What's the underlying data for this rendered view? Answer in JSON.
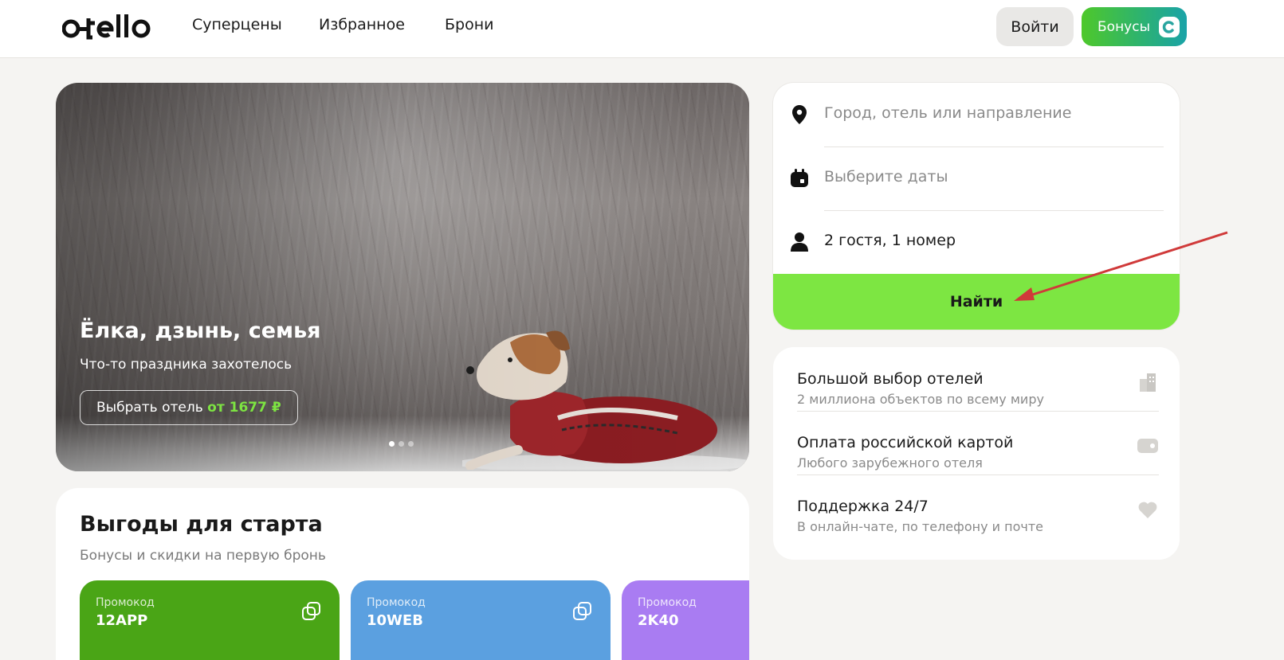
{
  "header": {
    "logo_text": "otello",
    "nav": [
      "Суперцены",
      "Избранное",
      "Брони"
    ],
    "login_label": "Войти",
    "bonus_label": "Бонусы"
  },
  "hero": {
    "title": "Ёлка, дзынь, семья",
    "subtitle": "Что-то праздника захотелось",
    "cta_prefix": "Выбрать отель",
    "cta_price": "от 1677 ₽",
    "slides_count": 3,
    "active_slide": 1
  },
  "search": {
    "destination_placeholder": "Город, отель или направление",
    "dates_placeholder": "Выберите даты",
    "guests_value": "2 гостя, 1 номер",
    "find_label": "Найти"
  },
  "features": [
    {
      "title": "Большой выбор отелей",
      "subtitle": "2 миллиона объектов по всему миру",
      "icon": "buildings-icon"
    },
    {
      "title": "Оплата российской картой",
      "subtitle": "Любого зарубежного отеля",
      "icon": "card-icon"
    },
    {
      "title": "Поддержка 24/7",
      "subtitle": "В онлайн-чате, по телефону и почте",
      "icon": "heart-icon"
    }
  ],
  "benefits": {
    "title": "Выгоды для старта",
    "subtitle": "Бонусы и скидки на первую бронь",
    "promos": [
      {
        "label": "Промокод",
        "code": "12APP",
        "color": "#4aa516"
      },
      {
        "label": "Промокод",
        "code": "10WEB",
        "color": "#5ba0e0"
      },
      {
        "label": "Промокод",
        "code": "2K40",
        "color": "#a97cf2"
      }
    ]
  },
  "colors": {
    "accent_green": "#7de642",
    "background": "#f5f4f2",
    "annotation_arrow": "#d03a3a"
  }
}
